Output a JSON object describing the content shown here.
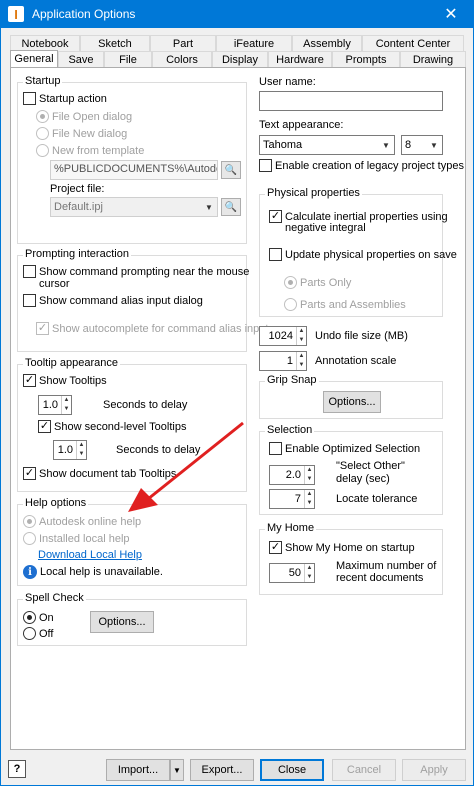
{
  "window": {
    "title": "Application Options",
    "app_icon": "I",
    "close": "✕"
  },
  "tabs_row1": [
    "Notebook",
    "Sketch",
    "Part",
    "iFeature",
    "Assembly",
    "Content Center"
  ],
  "tabs_row2": [
    "General",
    "Save",
    "File",
    "Colors",
    "Display",
    "Hardware",
    "Prompts",
    "Drawing"
  ],
  "startup": {
    "title": "Startup",
    "startup_action": "Startup action",
    "file_open": "File Open dialog",
    "file_new": "File New dialog",
    "new_from_template": "New from template",
    "template_path": "%PUBLICDOCUMENTS%\\Autodesk\\Inv",
    "project_file_label": "Project file:",
    "project_file_value": "Default.ipj"
  },
  "prompting": {
    "title": "Prompting interaction",
    "cmd_prompt_1": "Show command prompting near the mouse",
    "cmd_prompt_2": "cursor",
    "alias_input": "Show command alias input dialog",
    "autocomplete": "Show autocomplete for command alias input"
  },
  "tooltip": {
    "title": "Tooltip appearance",
    "show_tooltips": "Show Tooltips",
    "delay1_value": "1.0",
    "delay1_label": "Seconds to delay",
    "second_level": "Show second-level Tooltips",
    "delay2_value": "1.0",
    "delay2_label": "Seconds to delay",
    "doc_tab": "Show document tab Tooltips"
  },
  "help": {
    "title": "Help options",
    "online": "Autodesk online help",
    "local": "Installed local help",
    "download": "Download Local Help",
    "info": "Local help is unavailable."
  },
  "spell": {
    "title": "Spell Check",
    "on": "On",
    "off": "Off",
    "options": "Options..."
  },
  "right": {
    "user_name_label": "User name:",
    "user_name_value": "",
    "text_appearance_label": "Text appearance:",
    "font": "Tahoma",
    "font_size": "8",
    "legacy": "Enable creation of legacy project types",
    "physical_title": "Physical properties",
    "calc_inertial_1": "Calculate inertial properties using",
    "calc_inertial_2": "negative integral",
    "update_phys": "Update physical properties on save",
    "parts_only": "Parts Only",
    "parts_assemblies": "Parts and Assemblies",
    "undo_value": "1024",
    "undo_label": "Undo file size (MB)",
    "anno_value": "1",
    "anno_label": "Annotation scale",
    "grip_title": "Grip Snap",
    "grip_options": "Options...",
    "selection_title": "Selection",
    "optimized": "Enable Optimized Selection",
    "select_other_value": "2.0",
    "select_other_1": "\"Select Other\"",
    "select_other_2": "delay (sec)",
    "locate_value": "7",
    "locate_label": "Locate tolerance",
    "myhome_title": "My Home",
    "show_myhome": "Show My Home on startup",
    "max_recent_value": "50",
    "max_recent_1": "Maximum number of",
    "max_recent_2": "recent documents"
  },
  "footer": {
    "help_icon": "?",
    "import": "Import...",
    "export": "Export...",
    "close": "Close",
    "cancel": "Cancel",
    "apply": "Apply"
  },
  "colors": {
    "accent": "#0078d7",
    "arrow": "#e02020"
  }
}
